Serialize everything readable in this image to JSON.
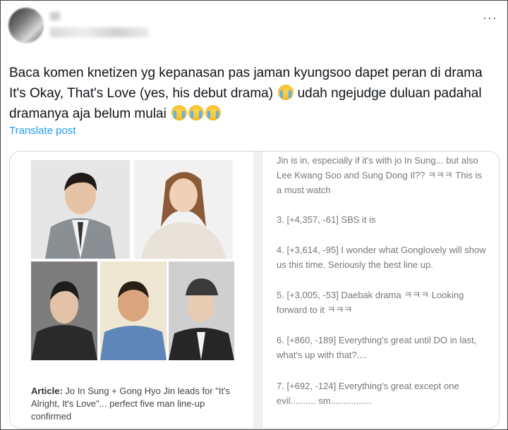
{
  "post": {
    "text_prefix": "Baca komen knetizen yg kepanasan pas jaman kyungsoo dapet peran di drama It's Okay, That's Love (yes, his debut drama) ",
    "text_middle": " udah ngejudge duluan padahal dramanya aja belum mulai ",
    "emoji_name": "loudly-crying-face",
    "translate_label": "Translate post",
    "more_label": "···"
  },
  "card": {
    "article_label": "Article:",
    "article_text": " Jo In Sung + Gong Hyo Jin leads for \"It's Alright, It's Love\"... perfect five man line-up confirmed",
    "comments": [
      "Jin is in, especially if it's with jo In Sung... but also Lee Kwang Soo and Sung Dong Il?? ㅋㅋㅋ This is a must watch",
      "3. [+4,357, -61] SBS it is",
      "4. [+3,614, -95] I wonder what Gonglovely will show us this time. Seriously the best line up.",
      "5. [+3,005, -53] Daebak drama ㅋㅋㅋ Looking forward to it ㅋㅋㅋ",
      "6. [+860, -189] Everything's great until DO in last, what's up with that?....",
      "7. [+692, -124] Everything's great except one evil.......... sm................"
    ]
  }
}
